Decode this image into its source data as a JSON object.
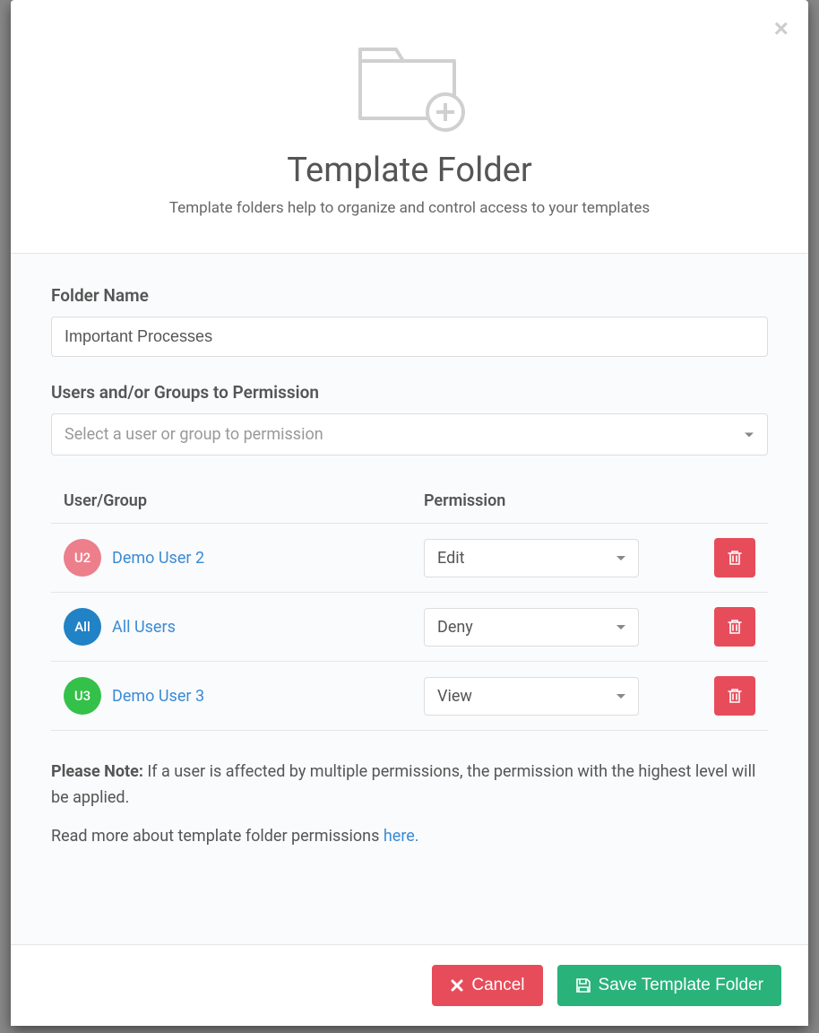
{
  "header": {
    "title": "Template Folder",
    "subtitle": "Template folders help to organize and control access to your templates"
  },
  "form": {
    "folder_name_label": "Folder Name",
    "folder_name_value": "Important Processes",
    "permission_label": "Users and/or Groups to Permission",
    "permission_placeholder": "Select a user or group to permission"
  },
  "table": {
    "header_user": "User/Group",
    "header_permission": "Permission",
    "rows": [
      {
        "avatar_text": "U2",
        "avatar_color": "#ec7f8b",
        "name": "Demo User 2",
        "permission": "Edit"
      },
      {
        "avatar_text": "All",
        "avatar_color": "#2182c5",
        "name": "All Users",
        "permission": "Deny"
      },
      {
        "avatar_text": "U3",
        "avatar_color": "#34c14a",
        "name": "Demo User 3",
        "permission": "View"
      }
    ]
  },
  "note": {
    "label": "Please Note:",
    "text": " If a user is affected by multiple permissions, the permission with the highest level will be applied.",
    "read_more_prefix": "Read more about template folder permissions ",
    "read_more_link": "here."
  },
  "footer": {
    "cancel": "Cancel",
    "save": "Save Template Folder"
  }
}
